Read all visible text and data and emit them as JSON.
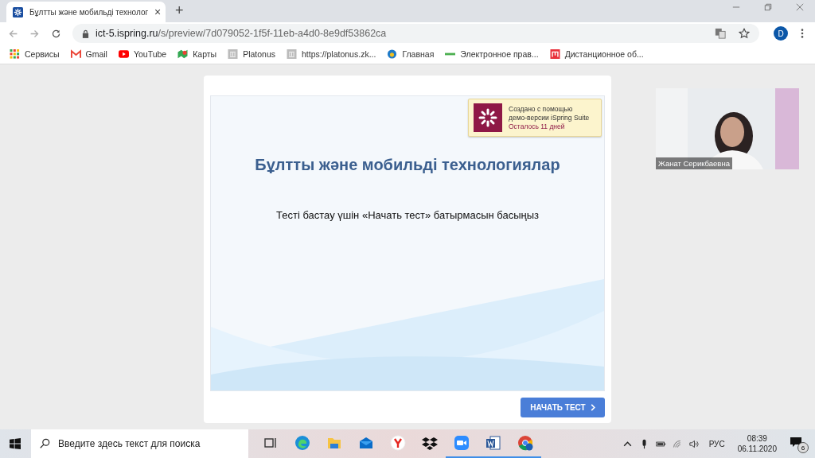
{
  "browser": {
    "tab": {
      "title": "Бұлтты және мобильді технолог",
      "close": "×"
    },
    "new_tab": "+",
    "url_host": "ict-5.ispring.ru",
    "url_path": "/s/preview/7d079052-1f5f-11eb-a4d0-8e9df53862ca",
    "profile": "D",
    "bookmarks": [
      {
        "label": "Сервисы",
        "kind": "apps"
      },
      {
        "label": "Gmail",
        "kind": "gmail"
      },
      {
        "label": "YouTube",
        "kind": "youtube"
      },
      {
        "label": "Карты",
        "kind": "maps"
      },
      {
        "label": "Platonus",
        "kind": "page"
      },
      {
        "label": "https://platonus.zk...",
        "kind": "page"
      },
      {
        "label": "Главная",
        "kind": "globe"
      },
      {
        "label": "Электронное прав...",
        "kind": "egov"
      },
      {
        "label": "Дистанционное об...",
        "kind": "moodle"
      }
    ]
  },
  "slide": {
    "demo_notice": {
      "line1": "Создано с помощью",
      "line2": "демо-версии iSpring Suite",
      "days_left": "Осталось 11 дней"
    },
    "title": "Бұлтты және мобильді технологиялар",
    "instruction": "Тесті бастау үшін «Начать тест» батырмасын басыңыз",
    "start_button": "НАЧАТЬ ТЕСТ"
  },
  "webcam": {
    "name": "Жанат Серикбаевна"
  },
  "taskbar": {
    "search_placeholder": "Введите здесь текст для поиска",
    "apps": [
      {
        "kind": "taskview",
        "running": false
      },
      {
        "kind": "edge",
        "running": false
      },
      {
        "kind": "explorer",
        "running": false
      },
      {
        "kind": "mail",
        "running": false
      },
      {
        "kind": "yandex",
        "running": false
      },
      {
        "kind": "dropbox",
        "running": false
      },
      {
        "kind": "zoom",
        "running": true
      },
      {
        "kind": "word",
        "running": true
      },
      {
        "kind": "chrome",
        "running": true
      }
    ],
    "language": "РУС",
    "time": "08:39",
    "date": "06.11.2020",
    "notifications": "6"
  }
}
